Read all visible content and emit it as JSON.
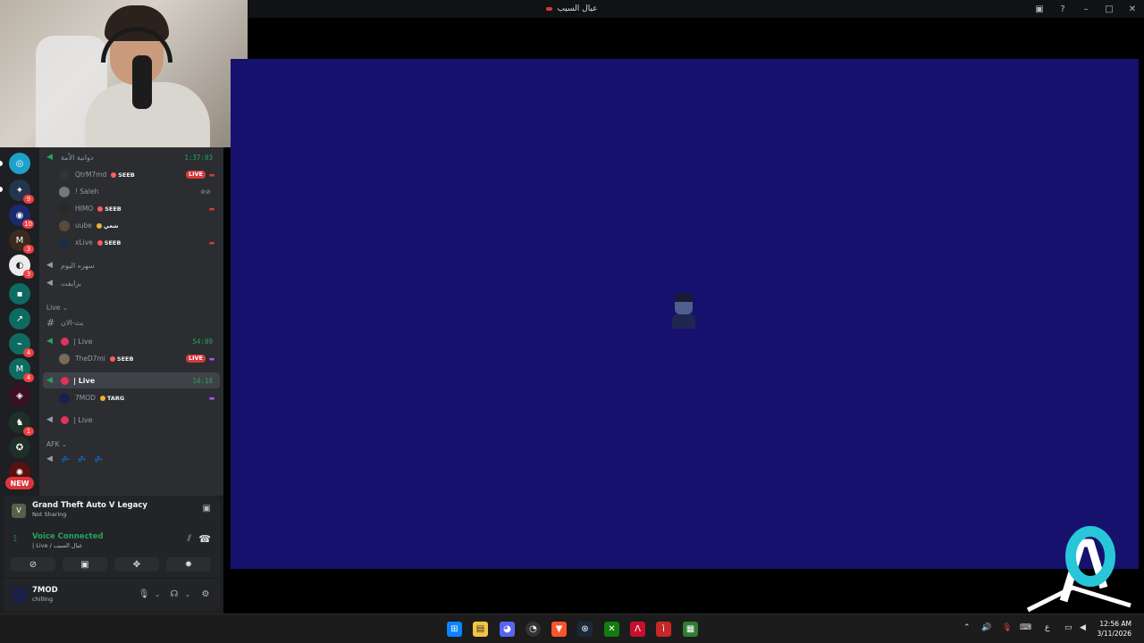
{
  "window": {
    "title": "عيال السيب"
  },
  "servers": [
    {
      "badge": ""
    },
    {
      "badge": "9"
    },
    {
      "badge": "10"
    },
    {
      "badge": "3"
    },
    {
      "badge": "3"
    },
    {
      "badge": ""
    },
    {
      "badge": ""
    },
    {
      "badge": "4"
    },
    {
      "badge": "4"
    },
    {
      "badge": ""
    },
    {
      "badge": "1"
    },
    {
      "badge": ""
    },
    {
      "badge": ""
    }
  ],
  "new_label": "NEW",
  "channels": {
    "ch1": {
      "name": "دوانية الأمة",
      "timer": "1:37:03"
    },
    "users1": [
      {
        "name": "QtrM7md",
        "tag": "SEEB",
        "live": "LIVE"
      },
      {
        "name": "! Saleh",
        "tag": "",
        "live": ""
      },
      {
        "name": "HIMO",
        "tag": "SEEB",
        "live": ""
      },
      {
        "name": "uube",
        "tag": "شعي",
        "live": ""
      },
      {
        "name": "xLive",
        "tag": "SEEB",
        "live": ""
      }
    ],
    "ch2": {
      "name": "سهره اليوم"
    },
    "ch3": {
      "name": "برايفت"
    },
    "cat_live": "Live ⌄",
    "text_channel": "بث-الان",
    "live1": {
      "name": "| Live",
      "timer": "54:09"
    },
    "live1_user": {
      "name": "TheD7mi",
      "tag": "SEEB",
      "live": "LIVE"
    },
    "live2": {
      "name": "| Live",
      "timer": "14:18"
    },
    "live2_user": {
      "name": "7MOD",
      "tag": "TARG"
    },
    "live3": {
      "name": "| Live"
    },
    "cat_afk": "AFK ⌄",
    "afk": {
      "name": "💤 💤 💤"
    }
  },
  "activity": {
    "game": "Grand Theft Auto V Legacy",
    "status": "Not Sharing"
  },
  "voice": {
    "title": "Voice Connected",
    "location": "| Live / عيال السيب"
  },
  "user": {
    "name": "7MOD",
    "status": "chilling"
  },
  "taskbar": {
    "lang": "ع",
    "time": "12:56 AM",
    "date": "3/11/2026"
  },
  "icons": [
    "speaker-icon",
    "hash-icon",
    "mic-icon",
    "headphones-icon",
    "gear-icon",
    "hangup-icon",
    "screen-share-icon"
  ]
}
